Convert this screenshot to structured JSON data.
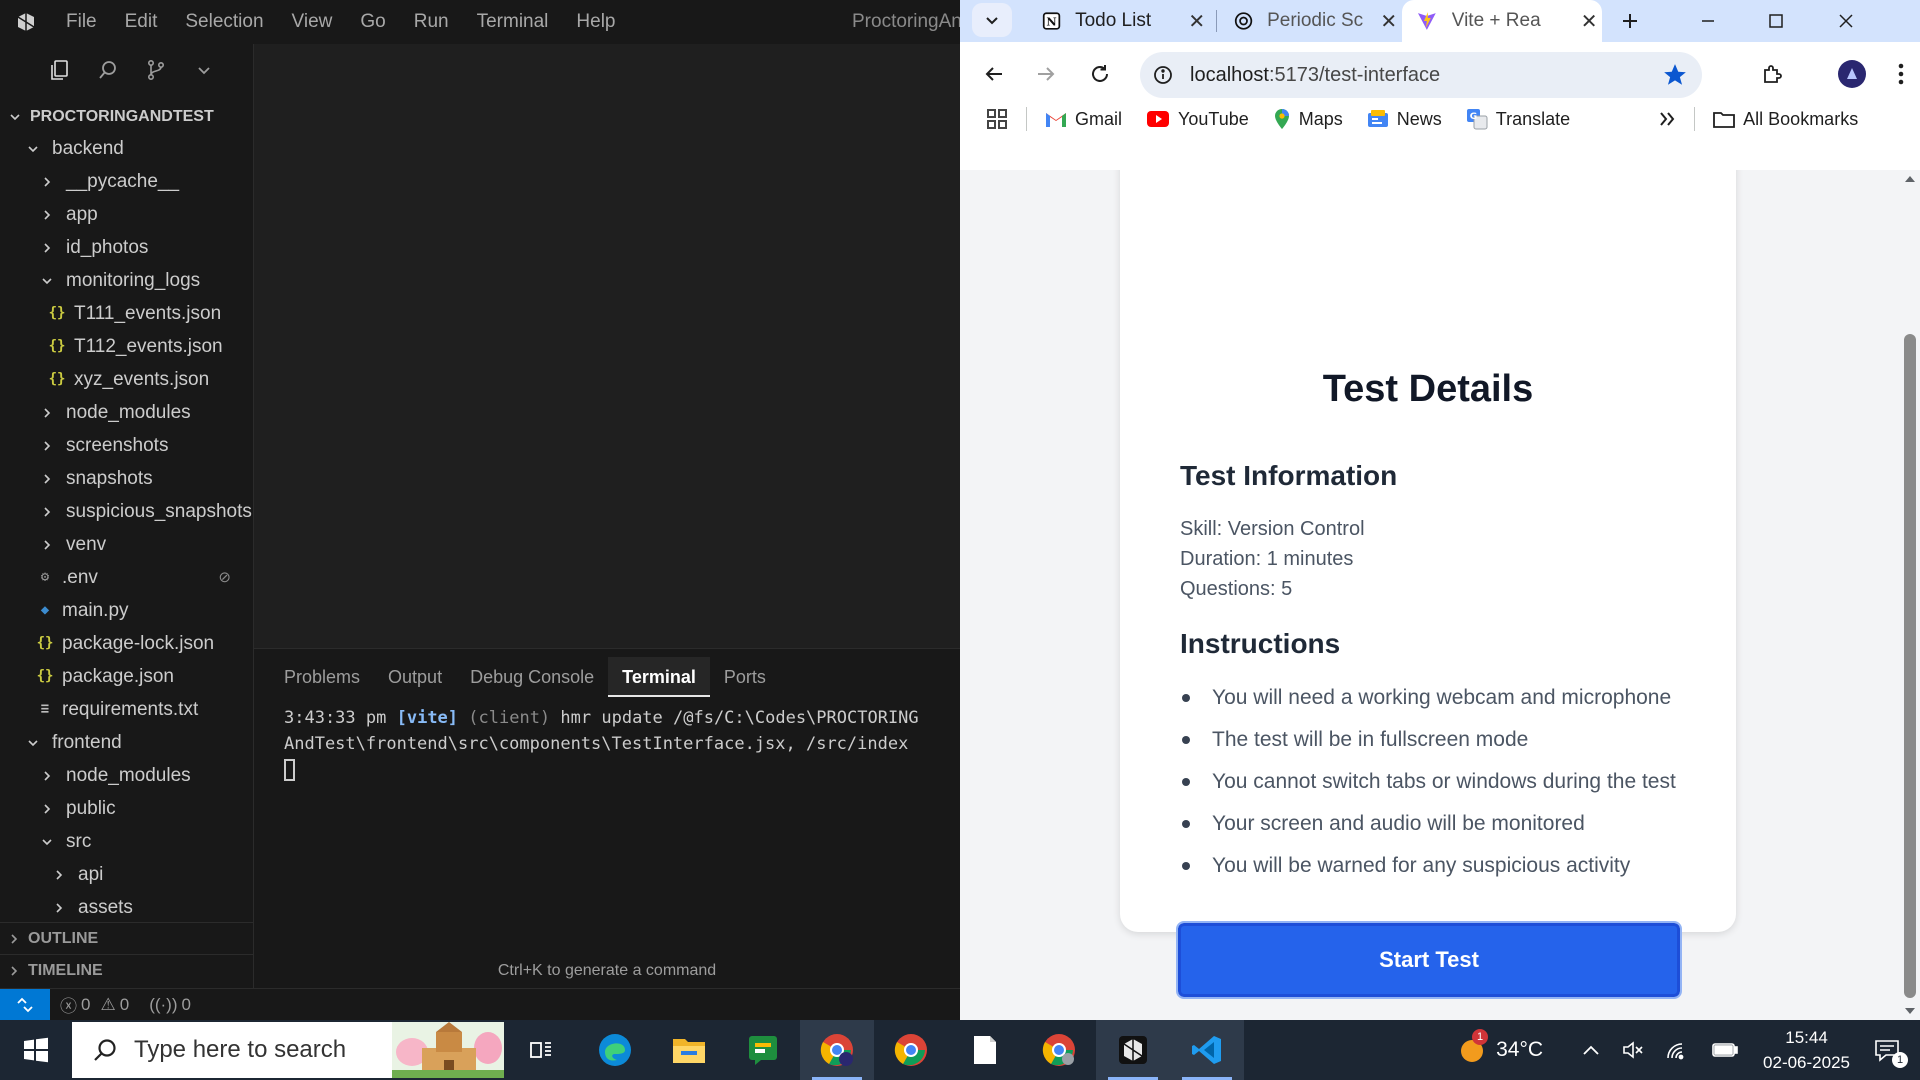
{
  "vscode": {
    "menu": [
      "File",
      "Edit",
      "Selection",
      "View",
      "Go",
      "Run",
      "Terminal",
      "Help"
    ],
    "window_title": "ProctoringAndT",
    "explorer": {
      "root": "PROCTORINGANDTEST",
      "backend": "backend",
      "items": {
        "pycache": "__pycache__",
        "app": "app",
        "id_photos": "id_photos",
        "monitoring_logs": "monitoring_logs",
        "t111": "T111_events.json",
        "t112": "T112_events.json",
        "xyz": "xyz_events.json",
        "node_modules": "node_modules",
        "screenshots": "screenshots",
        "snapshots": "snapshots",
        "suspicious_snapshots": "suspicious_snapshots",
        "venv": "venv",
        "env": ".env",
        "main_py": "main.py",
        "package_lock": "package-lock.json",
        "package_json": "package.json",
        "requirements": "requirements.txt",
        "frontend": "frontend",
        "fe_node_modules": "node_modules",
        "public": "public",
        "src": "src",
        "api": "api",
        "assets": "assets"
      },
      "outline": "OUTLINE",
      "timeline": "TIMELINE"
    },
    "panel": {
      "tabs": [
        "Problems",
        "Output",
        "Debug Console",
        "Terminal",
        "Ports"
      ],
      "terminal_time": "3:43:33 pm",
      "terminal_vite": "[vite]",
      "terminal_client": "(client)",
      "terminal_rest": "hmr update /@fs/C:\\Codes\\PROCTORING",
      "terminal_line2": "AndTest\\frontend\\src\\components\\TestInterface.jsx, /src/index",
      "hint": "Ctrl+K to generate a command"
    },
    "status": {
      "errors": "0",
      "warnings": "0",
      "ports": "0"
    }
  },
  "chrome": {
    "tabs": [
      {
        "title": "Todo List"
      },
      {
        "title": "Periodic Sc"
      },
      {
        "title": "Vite + Rea"
      }
    ],
    "url_host": "localhost",
    "url_path": ":5173/test-interface",
    "bookmarks": [
      "Gmail",
      "YouTube",
      "Maps",
      "News",
      "Translate"
    ],
    "all_bookmarks": "All Bookmarks"
  },
  "page": {
    "title": "Test Details",
    "info_heading": "Test Information",
    "skill": "Skill: Version Control",
    "duration": "Duration: 1 minutes",
    "questions": "Questions: 5",
    "instructions_heading": "Instructions",
    "instructions": [
      "You will need a working webcam and microphone",
      "The test will be in fullscreen mode",
      "You cannot switch tabs or windows during the test",
      "Your screen and audio will be monitored",
      "You will be warned for any suspicious activity"
    ],
    "start_button": "Start Test"
  },
  "taskbar": {
    "search_placeholder": "Type here to search",
    "weather_temp": "34°C",
    "weather_badge": "1",
    "time": "15:44",
    "date": "02-06-2025",
    "notifications": "1"
  }
}
